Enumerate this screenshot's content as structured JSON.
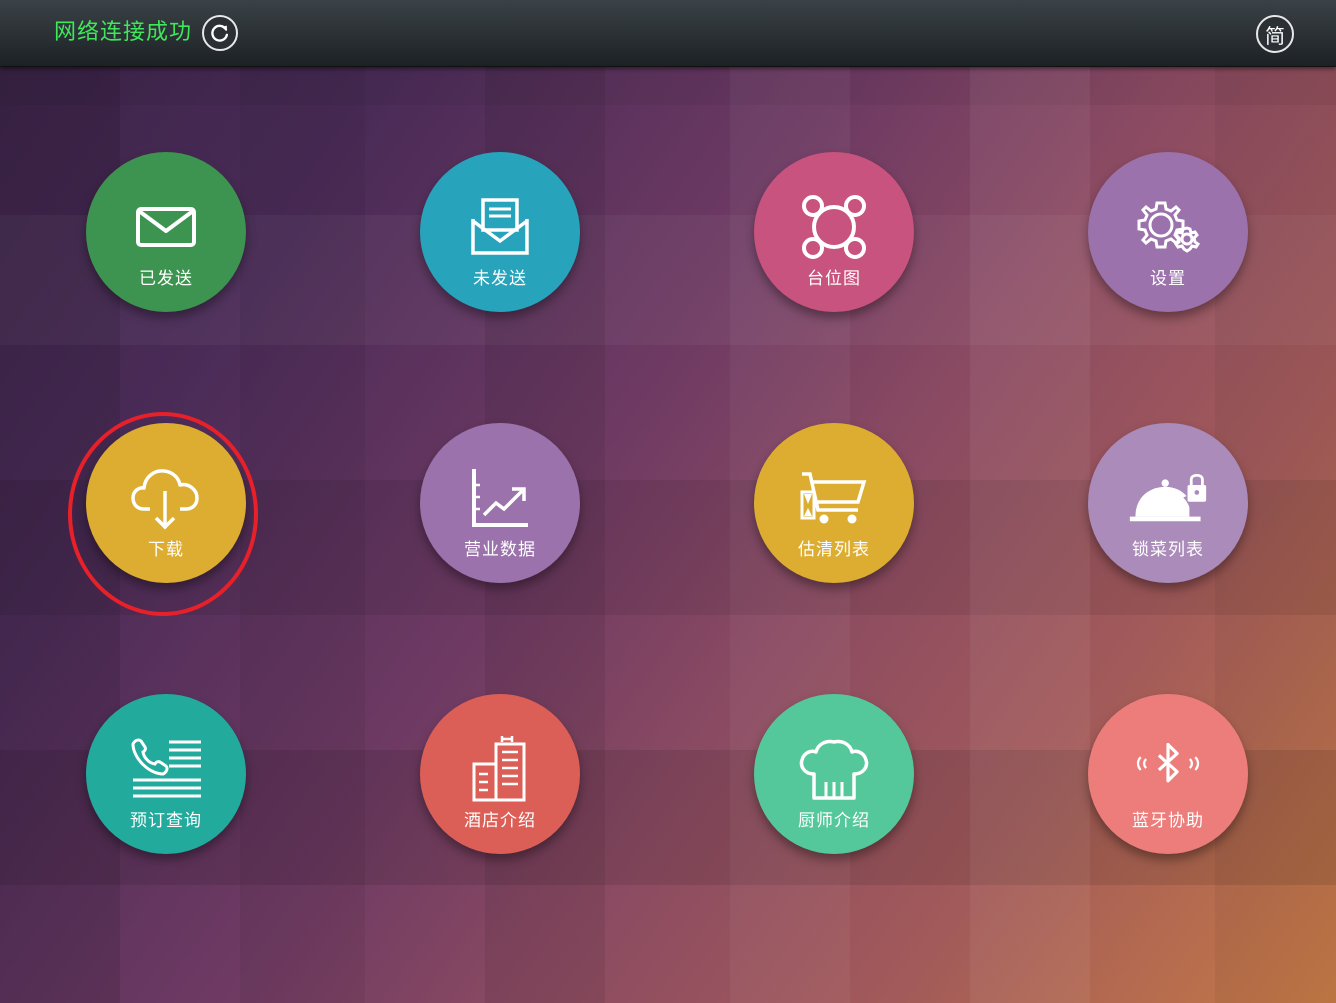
{
  "header": {
    "status_text": "网络连接成功",
    "lang_label": "简"
  },
  "tiles": [
    {
      "label": "已发送",
      "icon": "mail-icon",
      "color": "#3d9450"
    },
    {
      "label": "未发送",
      "icon": "envelope-document-icon",
      "color": "#27a3bc"
    },
    {
      "label": "台位图",
      "icon": "table-layout-icon",
      "color": "#c8537e"
    },
    {
      "label": "设置",
      "icon": "gears-icon",
      "color": "#9b72ab"
    },
    {
      "label": "下载",
      "icon": "cloud-download-icon",
      "color": "#dcad30"
    },
    {
      "label": "营业数据",
      "icon": "growth-chart-icon",
      "color": "#9b72ab"
    },
    {
      "label": "估清列表",
      "icon": "shopping-cart-icon",
      "color": "#dcad30"
    },
    {
      "label": "锁菜列表",
      "icon": "locked-cloche-icon",
      "color": "#ab8bb9"
    },
    {
      "label": "预订查询",
      "icon": "phone-list-icon",
      "color": "#22ab9d"
    },
    {
      "label": "酒店介绍",
      "icon": "hotel-building-icon",
      "color": "#dc5f57"
    },
    {
      "label": "厨师介绍",
      "icon": "chef-hat-icon",
      "color": "#55c89b"
    },
    {
      "label": "蓝牙协助",
      "icon": "bluetooth-icon",
      "color": "#ec7d7b"
    }
  ]
}
